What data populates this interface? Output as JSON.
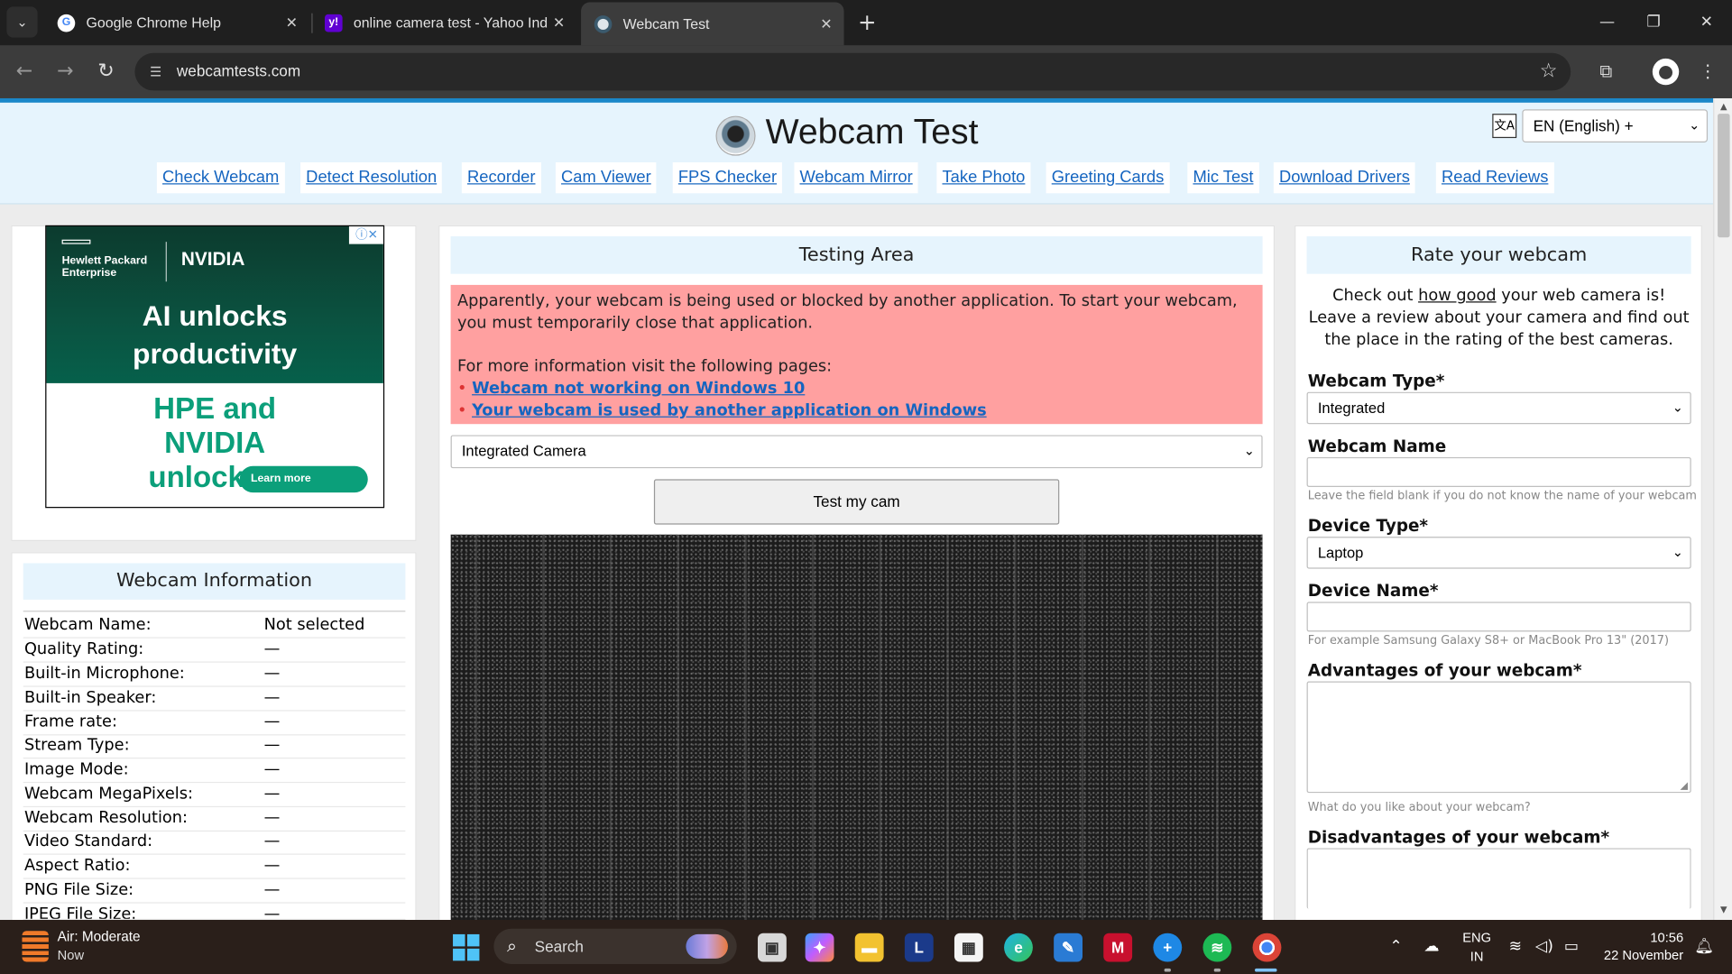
{
  "browser": {
    "tabs": [
      {
        "title": "Google Chrome Help",
        "favicon": "google-g-icon",
        "active": false
      },
      {
        "title": "online camera test - Yahoo Indi",
        "favicon": "yahoo-icon",
        "active": false
      },
      {
        "title": "Webcam Test",
        "favicon": "webcam-icon",
        "active": true
      }
    ],
    "url": "webcamtests.com"
  },
  "site": {
    "title": "Webcam Test",
    "language": "EN (English) +",
    "nav": [
      "Check Webcam",
      "Detect Resolution",
      "Recorder",
      "Cam Viewer",
      "FPS Checker",
      "Webcam Mirror",
      "Take Photo",
      "Greeting Cards",
      "Mic Test",
      "Download Drivers",
      "Read Reviews"
    ]
  },
  "ad": {
    "brand1": "Hewlett Packard Enterprise",
    "brand2": "NVIDIA",
    "headline": "AI unlocks productivity",
    "subhead": "HPE and NVIDIA unlock AI",
    "cta": "Learn more"
  },
  "webcam_info": {
    "title": "Webcam Information",
    "rows": [
      {
        "key": "Webcam Name:",
        "value": "Not selected"
      },
      {
        "key": "Quality Rating:",
        "value": "—"
      },
      {
        "key": "Built-in Microphone:",
        "value": "—"
      },
      {
        "key": "Built-in Speaker:",
        "value": "—"
      },
      {
        "key": "Frame rate:",
        "value": "—"
      },
      {
        "key": "Stream Type:",
        "value": "—"
      },
      {
        "key": "Image Mode:",
        "value": "—"
      },
      {
        "key": "Webcam MegaPixels:",
        "value": "—"
      },
      {
        "key": "Webcam Resolution:",
        "value": "—"
      },
      {
        "key": "Video Standard:",
        "value": "—"
      },
      {
        "key": "Aspect Ratio:",
        "value": "—"
      },
      {
        "key": "PNG File Size:",
        "value": "—"
      },
      {
        "key": "JPEG File Size:",
        "value": "—"
      }
    ]
  },
  "testing": {
    "title": "Testing Area",
    "alert_line1": "Apparently, your webcam is being used or blocked by another application. To start your webcam, you must temporarily close that application.",
    "alert_line2": "For more information visit the following pages:",
    "link1": "Webcam not working on Windows 10",
    "link2": "Your webcam is used by another application on Windows",
    "camera_select": "Integrated Camera",
    "button": "Test my cam"
  },
  "rate": {
    "title": "Rate your webcam",
    "intro_pre": "Check out ",
    "intro_link": "how good",
    "intro_post": " your web camera is! Leave a review about your camera and find out the place in the rating of the best cameras.",
    "webcam_type_label": "Webcam Type*",
    "webcam_type_value": "Integrated",
    "webcam_name_label": "Webcam Name",
    "webcam_name_hint": "Leave the field blank if you do not know the name of your webcam",
    "device_type_label": "Device Type*",
    "device_type_value": "Laptop",
    "device_name_label": "Device Name*",
    "device_name_hint": "For example Samsung Galaxy S8+ or MacBook Pro 13\" (2017)",
    "advantages_label": "Advantages of your webcam*",
    "advantages_hint": "What do you like about your webcam?",
    "disadvantages_label": "Disadvantages of your webcam*"
  },
  "taskbar": {
    "weather_title": "Air: Moderate",
    "weather_sub": "Now",
    "search_label": "Search",
    "lang1": "ENG",
    "lang2": "IN",
    "time": "10:56",
    "date": "22 November"
  }
}
